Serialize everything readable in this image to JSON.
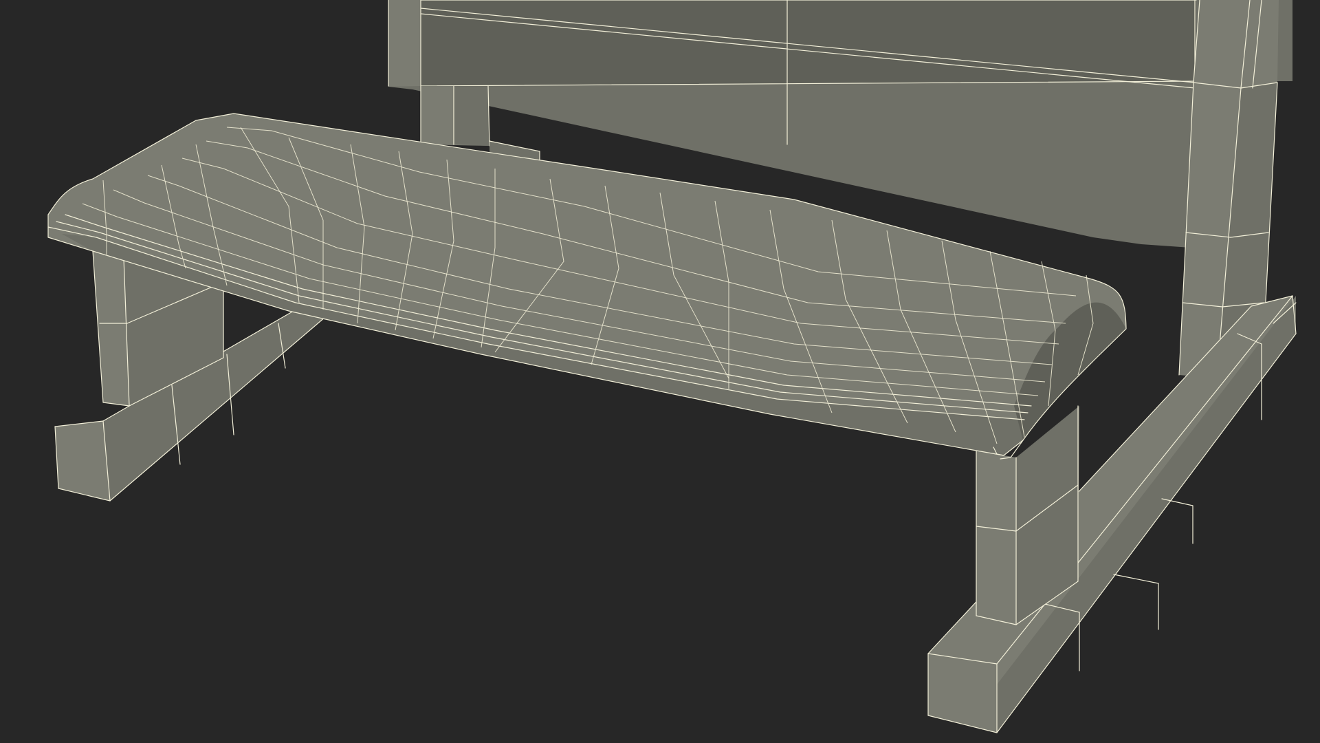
{
  "scene": {
    "background_color": "#272727",
    "model_color": "#7b7c72",
    "wire_color": "#f2efd8",
    "subject": "kneeler"
  }
}
